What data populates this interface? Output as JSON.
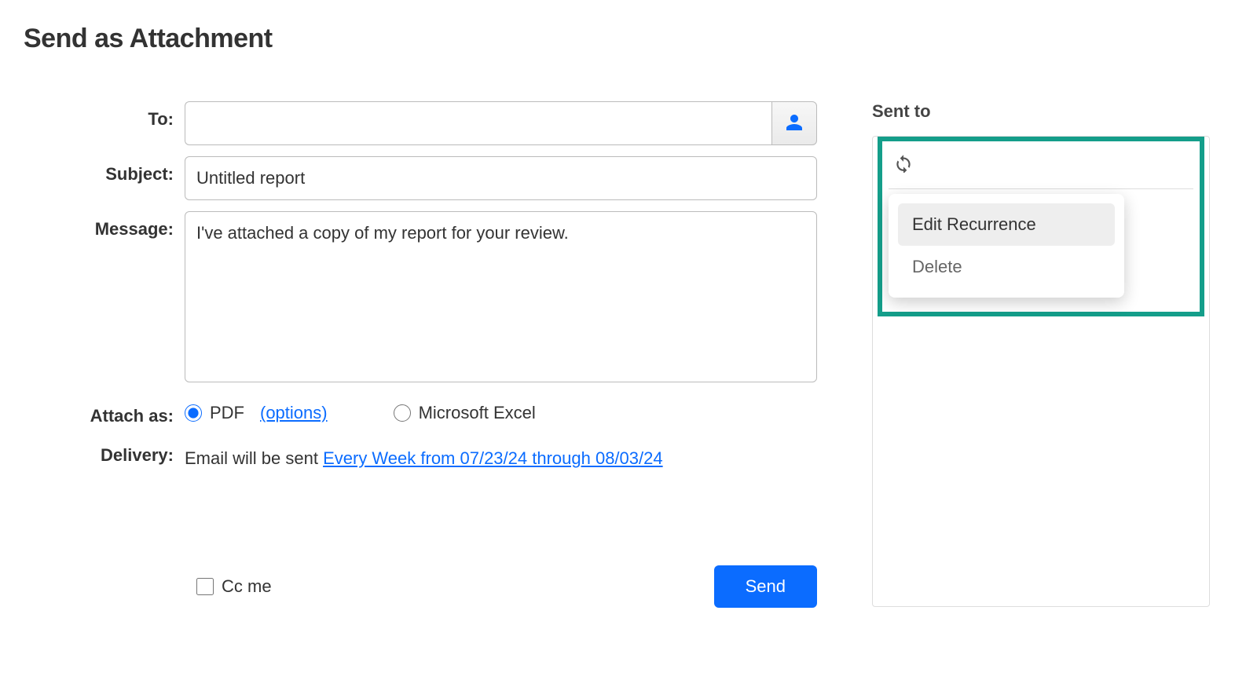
{
  "page_title": "Send as Attachment",
  "form": {
    "to": {
      "label": "To:",
      "value": ""
    },
    "subject": {
      "label": "Subject:",
      "value": "Untitled report"
    },
    "message": {
      "label": "Message:",
      "value": "I've attached a copy of my report for your review."
    },
    "attach_as": {
      "label": "Attach as:",
      "pdf_label": "PDF",
      "options_link": "(options)",
      "excel_label": "Microsoft Excel",
      "selected": "pdf"
    },
    "delivery": {
      "label": "Delivery:",
      "prefix": "Email will be sent ",
      "schedule_link": "Every Week from 07/23/24 through 08/03/24"
    },
    "cc_me_label": "Cc me",
    "send_label": "Send"
  },
  "sent_panel": {
    "title": "Sent to",
    "menu": {
      "edit": "Edit Recurrence",
      "delete": "Delete"
    }
  }
}
